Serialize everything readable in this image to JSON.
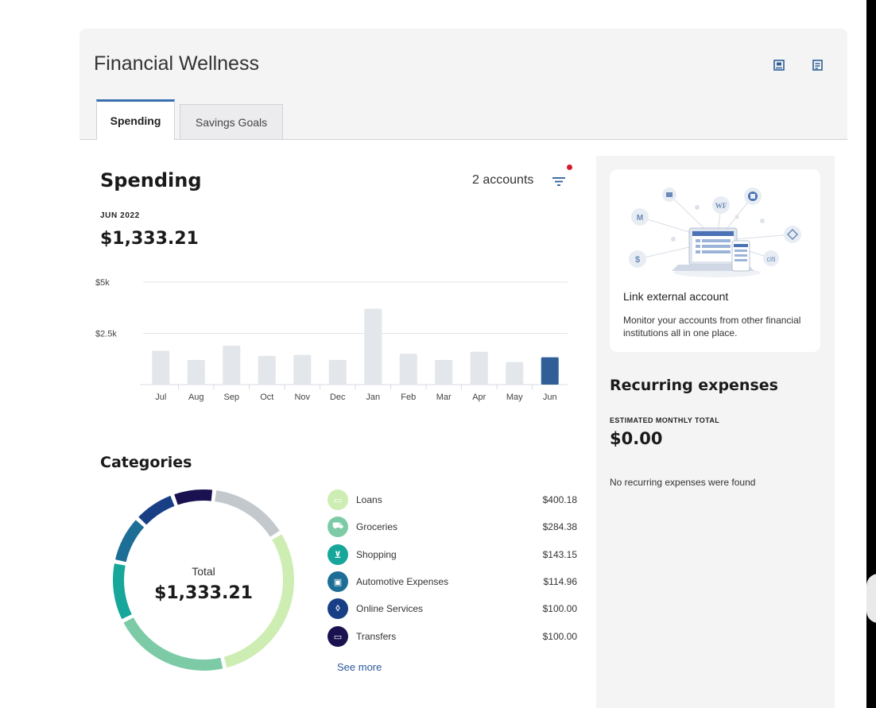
{
  "header": {
    "title": "Financial Wellness",
    "icons": [
      "pop-out-icon",
      "notes-icon"
    ]
  },
  "tabs": [
    {
      "label": "Spending",
      "active": true
    },
    {
      "label": "Savings Goals",
      "active": false
    }
  ],
  "spending": {
    "title": "Spending",
    "accounts_label": "2 accounts",
    "period": "JUN 2022",
    "total": "$1,333.21"
  },
  "chart_data": {
    "type": "bar",
    "categories": [
      "Jul",
      "Aug",
      "Sep",
      "Oct",
      "Nov",
      "Dec",
      "Jan",
      "Feb",
      "Mar",
      "Apr",
      "May",
      "Jun"
    ],
    "values": [
      1650,
      1200,
      1900,
      1400,
      1450,
      1200,
      3700,
      1500,
      1200,
      1600,
      1100,
      1333.21
    ],
    "highlight_index": 11,
    "ytick_labels": [
      "$5k",
      "$2.5k"
    ],
    "yticks": [
      5000,
      2500
    ],
    "ylim": [
      0,
      5000
    ],
    "colors": {
      "bar": "#e3e6ea",
      "highlight": "#2f5f96",
      "grid": "#e1e4e8"
    }
  },
  "categories": {
    "title": "Categories",
    "total_label": "Total",
    "total": "$1,333.21",
    "items": [
      {
        "name": "Loans",
        "amount": "$400.18",
        "value": 400.18,
        "color": "#cdedb3",
        "icon": "loans-icon",
        "glyph": "▭"
      },
      {
        "name": "Groceries",
        "amount": "$284.38",
        "value": 284.38,
        "color": "#7ccba6",
        "icon": "groceries-icon",
        "glyph": "⛟"
      },
      {
        "name": "Shopping",
        "amount": "$143.15",
        "value": 143.15,
        "color": "#16a69a",
        "icon": "shopping-cart-icon",
        "glyph": "⊻"
      },
      {
        "name": "Automotive Expenses",
        "amount": "$114.96",
        "value": 114.96,
        "color": "#1d6e96",
        "icon": "car-icon",
        "glyph": "▣"
      },
      {
        "name": "Online Services",
        "amount": "$100.00",
        "value": 100.0,
        "color": "#183f86",
        "icon": "plug-icon",
        "glyph": "◊"
      },
      {
        "name": "Transfers",
        "amount": "$100.00",
        "value": 100.0,
        "color": "#1a1250",
        "icon": "transfer-icon",
        "glyph": "▭"
      }
    ],
    "other_value": 190.54,
    "other_color": "#c3c8cd",
    "see_more": "See more"
  },
  "link_card": {
    "title": "Link external account",
    "description": "Monitor your accounts from other financial institutions all in one place."
  },
  "recurring": {
    "title": "Recurring expenses",
    "subtitle": "ESTIMATED MONTHLY TOTAL",
    "total": "$0.00",
    "empty_message": "No recurring expenses were found"
  }
}
